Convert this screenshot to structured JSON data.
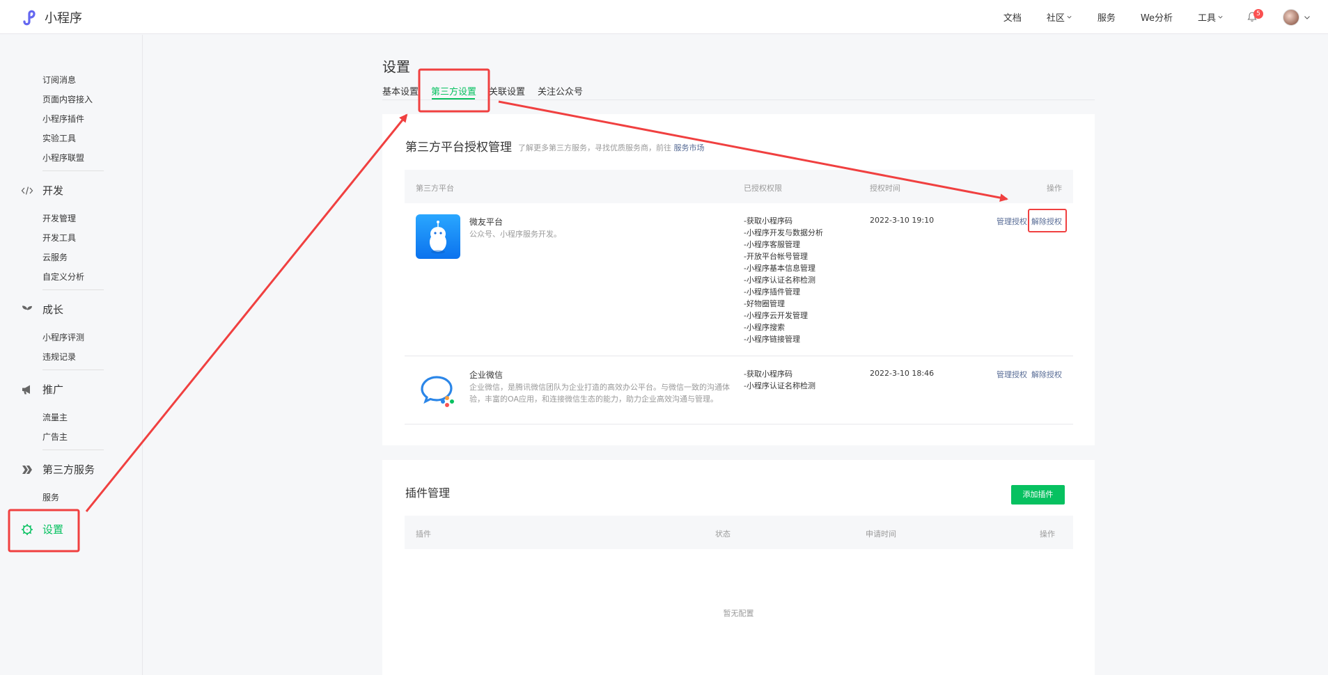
{
  "topbar": {
    "app_name": "小程序",
    "nav": [
      {
        "label": "文档",
        "dropdown": false
      },
      {
        "label": "社区",
        "dropdown": true
      },
      {
        "label": "服务",
        "dropdown": false
      },
      {
        "label": "We分析",
        "dropdown": false
      },
      {
        "label": "工具",
        "dropdown": true
      }
    ],
    "notification_count": "5"
  },
  "sidebar": {
    "group0": [
      "订阅消息",
      "页面内容接入",
      "小程序插件",
      "实验工具",
      "小程序联盟"
    ],
    "dev": {
      "label": "开发",
      "items": [
        "开发管理",
        "开发工具",
        "云服务",
        "自定义分析"
      ]
    },
    "growth": {
      "label": "成长",
      "items": [
        "小程序评测",
        "违规记录"
      ]
    },
    "promo": {
      "label": "推广",
      "items": [
        "流量主",
        "广告主"
      ]
    },
    "thirdparty": {
      "label": "第三方服务",
      "items": [
        "服务"
      ]
    },
    "settings": {
      "label": "设置"
    }
  },
  "page": {
    "title": "设置",
    "tabs": [
      "基本设置",
      "第三方设置",
      "关联设置",
      "关注公众号"
    ],
    "active_tab": "第三方设置"
  },
  "auth_section": {
    "title": "第三方平台授权管理",
    "subtitle": "了解更多第三方服务，寻找优质服务商，前往",
    "subtitle_link": "服务市场",
    "columns": [
      "第三方平台",
      "已授权权限",
      "授权时间",
      "操作"
    ],
    "rows": [
      {
        "name": "微友平台",
        "desc": "公众号、小程序服务开发。",
        "permissions": [
          "-获取小程序码",
          "-小程序开发与数据分析",
          "-小程序客服管理",
          "-开放平台帐号管理",
          "-小程序基本信息管理",
          "-小程序认证名称检测",
          "-小程序插件管理",
          "-好物圈管理",
          "-小程序云开发管理",
          "-小程序搜索",
          "-小程序链接管理"
        ],
        "time": "2022-3-10 19:10",
        "op_manage": "管理授权",
        "op_revoke": "解除授权"
      },
      {
        "name": "企业微信",
        "desc": "企业微信，是腾讯微信团队为企业打造的高效办公平台。与微信一致的沟通体验，丰富的OA应用，和连接微信生态的能力，助力企业高效沟通与管理。",
        "permissions": [
          "-获取小程序码",
          "-小程序认证名称检测"
        ],
        "time": "2022-3-10 18:46",
        "op_manage": "管理授权",
        "op_revoke": "解除授权"
      }
    ]
  },
  "plugin_section": {
    "title": "插件管理",
    "add_button": "添加插件",
    "columns": [
      "插件",
      "状态",
      "申请时间",
      "操作"
    ],
    "empty_text": "暂无配置"
  },
  "colors": {
    "brand_green": "#07c160",
    "link_blue": "#576b95",
    "annotation_red": "#f04040"
  }
}
